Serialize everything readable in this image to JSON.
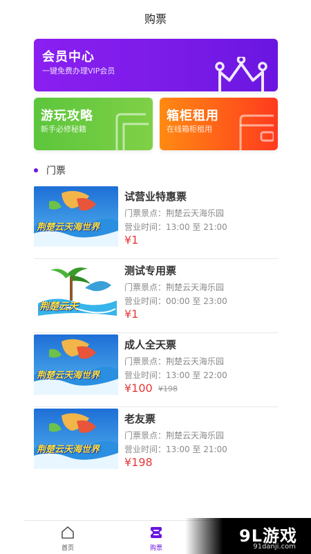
{
  "header": {
    "title": "购票"
  },
  "cards": {
    "vip": {
      "title": "会员中心",
      "subtitle": "一键免费办理VIP会员",
      "icon": "crown-icon"
    },
    "guide": {
      "title": "游玩攻略",
      "subtitle": "新手必修秘籍",
      "icon": "card-outline-icon"
    },
    "locker": {
      "title": "箱柜租用",
      "subtitle": "在线箱柜租用",
      "icon": "wallet-outline-icon"
    }
  },
  "section": {
    "title": "门票"
  },
  "tickets": [
    {
      "name": "试营业特惠票",
      "venue": "门票景点：荆楚云天海乐园",
      "hours": "营业时间：13:00 至 21:00",
      "price": "¥1",
      "original": "",
      "image_text": "荆楚云天海世界"
    },
    {
      "name": "测试专用票",
      "venue": "门票景点：荆楚云天海乐园",
      "hours": "营业时间：00:00 至 23:00",
      "price": "¥1",
      "original": "",
      "image_text": "荆楚云天"
    },
    {
      "name": "成人全天票",
      "venue": "门票景点：荆楚云天海乐园",
      "hours": "营业时间：13:00 至 22:00",
      "price": "¥100",
      "original": "¥198",
      "image_text": "荆楚云天海世界"
    },
    {
      "name": "老友票",
      "venue": "门票景点：荆楚云天海乐园",
      "hours": "营业时间：13:00 至 21:00",
      "price": "¥198",
      "original": "",
      "image_text": "荆楚云天海世界"
    }
  ],
  "tabbar": {
    "home": {
      "label": "首页",
      "icon": "home-icon"
    },
    "buy": {
      "label": "购票",
      "icon": "ticket-icon",
      "active": true
    }
  },
  "watermark": {
    "text": "9L游戏",
    "site": "91danji.com"
  },
  "colors": {
    "accent": "#6a16e0",
    "price": "#e53939",
    "vip": "#7a1be8",
    "guide": "#6ccb40",
    "locker": "#ff5a1a"
  }
}
